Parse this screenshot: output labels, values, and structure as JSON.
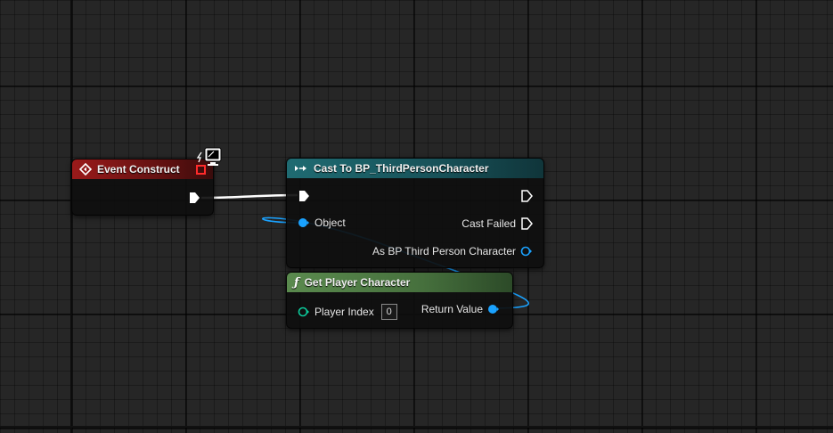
{
  "colors": {
    "event_header": "#9a1a1a",
    "cast_header": "#1f6b72",
    "pure_header": "#5a8a4e",
    "object_pin": "#1aa2ff",
    "struct_pin": "#0cc99a",
    "exec_pin": "#ffffff"
  },
  "event_node": {
    "title": "Event Construct",
    "icon": "event-diamond-icon"
  },
  "cast_node": {
    "title": "Cast To BP_ThirdPersonCharacter",
    "icon": "cast-arrows-icon",
    "object_label": "Object",
    "cast_failed_label": "Cast Failed",
    "as_label": "As BP Third Person Character"
  },
  "get_player_node": {
    "title": "Get Player Character",
    "icon": "function-icon",
    "player_index_label": "Player Index",
    "player_index_value": "0",
    "return_label": "Return Value"
  }
}
